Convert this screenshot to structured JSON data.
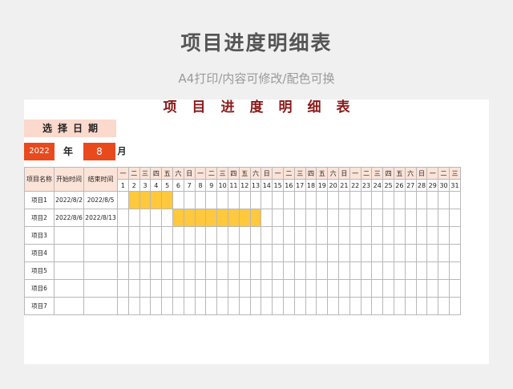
{
  "page": {
    "title": "项目进度明细表",
    "subtitle": "A4打印/内容可修改/配色可换"
  },
  "sheet": {
    "title": "项目进度明细表",
    "choose_date": "选择日期",
    "year": "2022",
    "year_label": "年",
    "month": "8",
    "month_label": "月",
    "columns": {
      "name": "项目名称",
      "start": "开始时间",
      "end": "结束时间"
    },
    "weekdays": [
      "一",
      "二",
      "三",
      "四",
      "五",
      "六",
      "日",
      "一",
      "二",
      "三",
      "四",
      "五",
      "六",
      "日",
      "一",
      "二",
      "三",
      "四",
      "五",
      "六",
      "日",
      "一",
      "二",
      "三",
      "四",
      "五",
      "六",
      "日",
      "一",
      "二",
      "三"
    ],
    "days": [
      "1",
      "2",
      "3",
      "4",
      "5",
      "6",
      "7",
      "8",
      "9",
      "10",
      "11",
      "12",
      "13",
      "14",
      "15",
      "16",
      "17",
      "18",
      "19",
      "20",
      "21",
      "22",
      "23",
      "24",
      "25",
      "26",
      "27",
      "28",
      "29",
      "30",
      "31"
    ],
    "rows": [
      {
        "name": "项目1",
        "start": "2022/8/2",
        "end": "2022/8/5",
        "bar_start_day": 2,
        "bar_end_day": 5
      },
      {
        "name": "项目2",
        "start": "2022/8/6",
        "end": "2022/8/13",
        "bar_start_day": 6,
        "bar_end_day": 13
      },
      {
        "name": "项目3",
        "start": "",
        "end": ""
      },
      {
        "name": "项目4",
        "start": "",
        "end": ""
      },
      {
        "name": "项目5",
        "start": "",
        "end": ""
      },
      {
        "name": "项目6",
        "start": "",
        "end": ""
      },
      {
        "name": "项目7",
        "start": "",
        "end": ""
      }
    ]
  },
  "colors": {
    "accent": "#e84a1e",
    "bar": "#ffc83d",
    "header_bg": "#fbe3d8",
    "title_red": "#8b1a1a"
  }
}
